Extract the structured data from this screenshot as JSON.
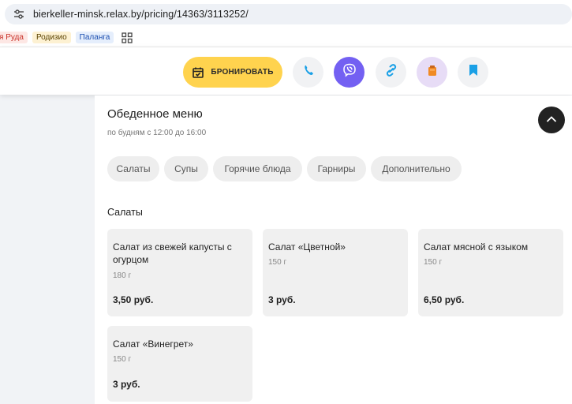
{
  "browser": {
    "url": "bierkeller-minsk.relax.by/pricing/14363/3113252/",
    "bookmarks": [
      "я Руда",
      "Родизио",
      "Паланга"
    ]
  },
  "header": {
    "book_label": "БРОНИРОВАТЬ",
    "icons": [
      "calendar-icon",
      "phone-icon",
      "viber-icon",
      "link-icon",
      "bag-icon",
      "bookmark-icon"
    ],
    "colors": {
      "book": "#ffd34e",
      "viber": "#7360f2",
      "accent": "#1aa0e6"
    }
  },
  "menu": {
    "title": "Обеденное меню",
    "subtitle": "по будням с 12:00 до 16:00",
    "categories": [
      "Салаты",
      "Супы",
      "Горячие блюда",
      "Гарниры",
      "Дополнительно"
    ],
    "section_title": "Салаты",
    "dishes": [
      {
        "name": "Салат из свежей капусты с огурцом",
        "weight": "180 г",
        "price": "3,50 руб."
      },
      {
        "name": "Салат «Цветной»",
        "weight": "150 г",
        "price": "3 руб."
      },
      {
        "name": "Салат мясной с языком",
        "weight": "150 г",
        "price": "6,50 руб."
      },
      {
        "name": "Салат «Винегрет»",
        "weight": "150 г",
        "price": "3 руб."
      }
    ]
  }
}
